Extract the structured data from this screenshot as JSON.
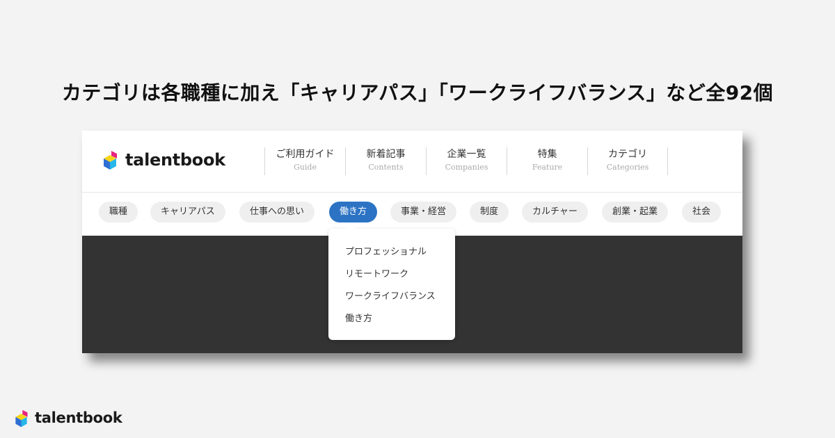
{
  "headline": "カテゴリは各職種に加え「キャリアパス」「ワークライフバランス」など全92個",
  "brand": {
    "name": "talentbook",
    "colors": {
      "blue": "#2f6fd4",
      "cyan": "#27b6ea",
      "yellow": "#f7d417",
      "magenta": "#e6247e"
    }
  },
  "nav": [
    {
      "jp": "ご利用ガイド",
      "en": "Guide"
    },
    {
      "jp": "新着記事",
      "en": "Contents"
    },
    {
      "jp": "企業一覧",
      "en": "Companies"
    },
    {
      "jp": "特集",
      "en": "Feature"
    },
    {
      "jp": "カテゴリ",
      "en": "Categories"
    }
  ],
  "categories": [
    {
      "label": "職種"
    },
    {
      "label": "キャリアパス"
    },
    {
      "label": "仕事への思い"
    },
    {
      "label": "働き方",
      "active": true
    },
    {
      "label": "事業・経営"
    },
    {
      "label": "制度"
    },
    {
      "label": "カルチャー"
    },
    {
      "label": "創業・起業"
    },
    {
      "label": "社会"
    }
  ],
  "dropdown": {
    "items": [
      "プロフェッショナル",
      "リモートワーク",
      "ワークライフバランス",
      "働き方"
    ]
  },
  "accent_color": "#2c73c4"
}
